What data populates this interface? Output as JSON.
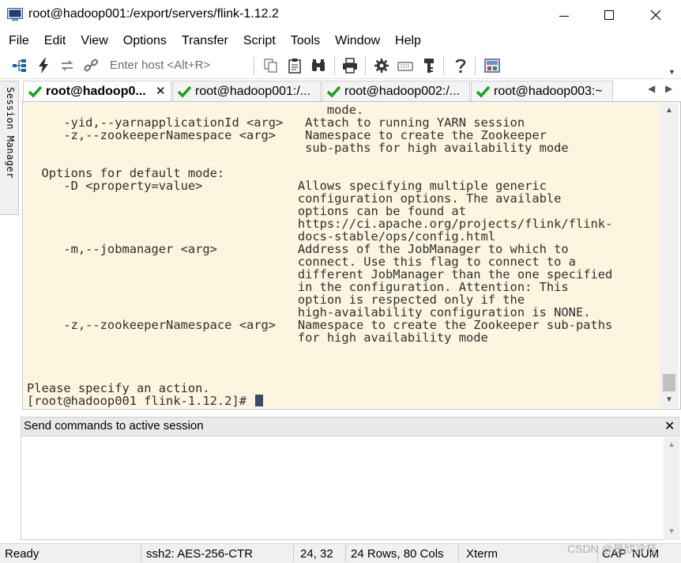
{
  "window": {
    "title": "root@hadoop001:/export/servers/flink-1.12.2"
  },
  "menu": [
    "File",
    "Edit",
    "View",
    "Options",
    "Transfer",
    "Script",
    "Tools",
    "Window",
    "Help"
  ],
  "toolbar": {
    "host_placeholder": "Enter host <Alt+R>"
  },
  "side": {
    "session_manager_label": "Session Manager"
  },
  "tabs": [
    {
      "label": "root@hadoop0...",
      "active": true
    },
    {
      "label": "root@hadoop001:/...",
      "active": false
    },
    {
      "label": "root@hadoop002:/...",
      "active": false
    },
    {
      "label": "root@hadoop003:~",
      "active": false
    }
  ],
  "terminal": {
    "lines": [
      "                                         mode.",
      "     -yid,--yarnapplicationId <arg>   Attach to running YARN session",
      "     -z,--zookeeperNamespace <arg>    Namespace to create the Zookeeper",
      "                                      sub-paths for high availability mode",
      "",
      "  Options for default mode:",
      "     -D <property=value>             Allows specifying multiple generic",
      "                                     configuration options. The available",
      "                                     options can be found at",
      "                                     https://ci.apache.org/projects/flink/flink-",
      "                                     docs-stable/ops/config.html",
      "     -m,--jobmanager <arg>           Address of the JobManager to which to",
      "                                     connect. Use this flag to connect to a",
      "                                     different JobManager than the one specified",
      "                                     in the configuration. Attention: This",
      "                                     option is respected only if the",
      "                                     high-availability configuration is NONE.",
      "     -z,--zookeeperNamespace <arg>   Namespace to create the Zookeeper sub-paths",
      "                                     for high availability mode",
      "",
      "",
      "",
      "Please specify an action.",
      "[root@hadoop001 flink-1.12.2]# "
    ]
  },
  "command_pane": {
    "title": "Send commands to active session"
  },
  "status": {
    "ready": "Ready",
    "cipher": "ssh2: AES-256-CTR",
    "position": "24,  32",
    "size": "24 Rows, 80 Cols",
    "term": "Xterm",
    "caps": "CAP",
    "num": "NUM"
  },
  "watermark": "CSDN @是欣冷枝"
}
